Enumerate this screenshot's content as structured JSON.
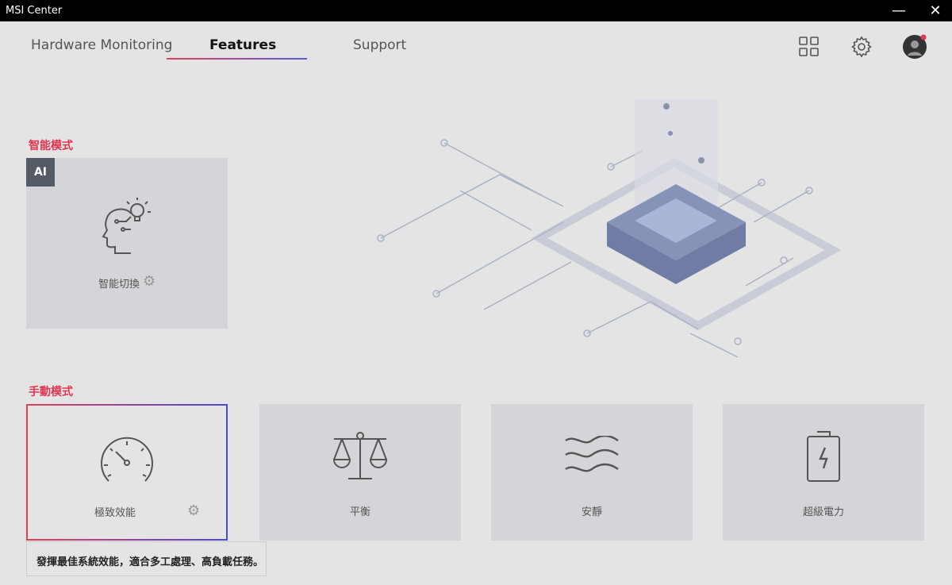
{
  "window": {
    "title": "MSI Center",
    "minimize": "—",
    "close": "✕"
  },
  "tabs": [
    {
      "label": "Hardware Monitoring"
    },
    {
      "label": "Features"
    },
    {
      "label": "Support"
    }
  ],
  "smart_mode": {
    "heading": "智能模式",
    "badge": "AI",
    "card_label": "智能切換"
  },
  "manual_mode": {
    "heading": "手動模式",
    "cards": [
      {
        "label": "極致效能"
      },
      {
        "label": "平衡"
      },
      {
        "label": "安靜"
      },
      {
        "label": "超級電力"
      }
    ]
  },
  "tooltip": "發揮最佳系統效能，適合多工處理、高負載任務。",
  "colors": {
    "accent_red": "#e0354f",
    "accent_blue": "#4a4ad8"
  }
}
